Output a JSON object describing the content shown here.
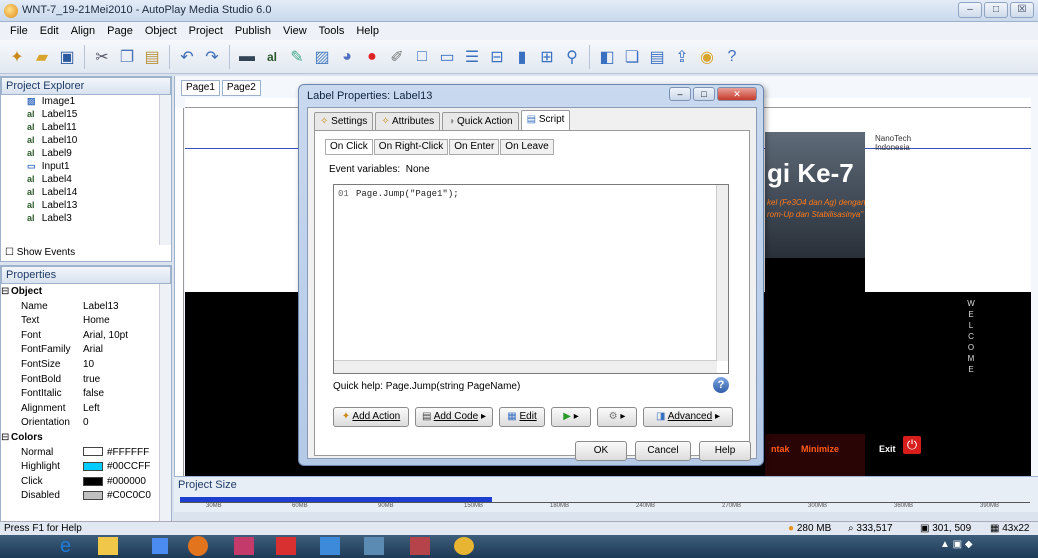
{
  "window": {
    "title": "WNT-7_19-21Mei2010 - AutoPlay Media Studio 6.0",
    "min": "–",
    "max": "□",
    "close": "☒"
  },
  "menu": [
    "File",
    "Edit",
    "Align",
    "Page",
    "Object",
    "Project",
    "Publish",
    "View",
    "Tools",
    "Help"
  ],
  "project_explorer": {
    "title": "Project Explorer",
    "items": [
      {
        "icon": "img",
        "label": "Image1"
      },
      {
        "icon": "al",
        "label": "Label15"
      },
      {
        "icon": "al",
        "label": "Label11"
      },
      {
        "icon": "al",
        "label": "Label10"
      },
      {
        "icon": "al",
        "label": "Label9"
      },
      {
        "icon": "in",
        "label": "Input1"
      },
      {
        "icon": "al",
        "label": "Label4"
      },
      {
        "icon": "al",
        "label": "Label14"
      },
      {
        "icon": "al",
        "label": "Label13"
      },
      {
        "icon": "al",
        "label": "Label3"
      }
    ],
    "show_events": "Show Events"
  },
  "properties": {
    "title": "Properties",
    "rows": [
      {
        "k": "Object",
        "v": "",
        "group": true
      },
      {
        "k": "Name",
        "v": "Label13"
      },
      {
        "k": "Text",
        "v": "Home"
      },
      {
        "k": "Font",
        "v": "Arial, 10pt"
      },
      {
        "k": "FontFamily",
        "v": "Arial"
      },
      {
        "k": "FontSize",
        "v": "10"
      },
      {
        "k": "FontBold",
        "v": "true"
      },
      {
        "k": "FontItalic",
        "v": "false"
      },
      {
        "k": "Alignment",
        "v": "Left"
      },
      {
        "k": "Orientation",
        "v": "0"
      },
      {
        "k": "Colors",
        "v": "",
        "group": true
      },
      {
        "k": "Normal",
        "v": "#FFFFFF",
        "color": "#FFFFFF"
      },
      {
        "k": "Highlight",
        "v": "#00CCFF",
        "color": "#00CCFF"
      },
      {
        "k": "Click",
        "v": "#000000",
        "color": "#000000"
      },
      {
        "k": "Disabled",
        "v": "#C0C0C0",
        "color": "#C0C0C0"
      }
    ]
  },
  "page_tabs": [
    "Page1",
    "Page2"
  ],
  "page_content": {
    "title_big": "gi Ke-7",
    "logo": "NanoTech Indonesia",
    "subtitle1": "kel (Fe3O4 dan Ag) dengan",
    "subtitle2": "rom-Up dan Stabilisasinya\"",
    "vertical": "WELCOME",
    "bottom_left": "ntak",
    "minimize": "Minimize",
    "exit": "Exit"
  },
  "project_size": {
    "label": "Project Size",
    "ticks": [
      "30MB",
      "60MB",
      "90MB",
      "150MB",
      "180MB",
      "240MB",
      "270MB",
      "300MB",
      "360MB",
      "390MB"
    ]
  },
  "status": {
    "help": "Press F1 for Help",
    "mem": "280 MB",
    "coords": "333,517",
    "size": "301, 509",
    "dims": "43x22"
  },
  "dialog": {
    "title": "Label Properties: Label13",
    "tabs": [
      "Settings",
      "Attributes",
      "Quick Action",
      "Script"
    ],
    "active_tab": "Script",
    "subtabs": [
      "On Click",
      "On Right-Click",
      "On Enter",
      "On Leave"
    ],
    "event_label": "Event variables:",
    "event_value": "None",
    "code_line_no": "01",
    "code_text": "Page.Jump(\"Page1\");",
    "quick_help": "Quick help:  Page.Jump(string PageName)",
    "action_buttons": [
      "Add Action",
      "Add Code",
      "Edit"
    ],
    "advanced": "Advanced",
    "ok": "OK",
    "cancel": "Cancel",
    "help": "Help"
  }
}
